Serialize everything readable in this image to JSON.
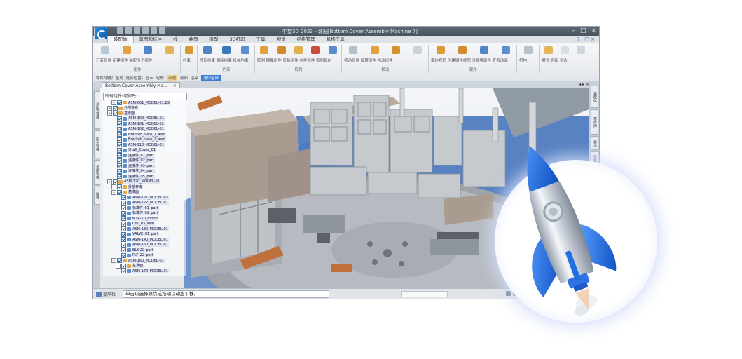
{
  "title_bar": {
    "text": "中望3D 2023 - 装配[Bottom Cover Assembly Machine 7]",
    "minimize": "–",
    "restore": "□",
    "close": "×"
  },
  "ribbon_tabs": [
    {
      "label": "装配体"
    },
    {
      "label": "草图和标注"
    },
    {
      "label": "线"
    },
    {
      "label": "曲面"
    },
    {
      "label": "造型"
    },
    {
      "label": "3D打印"
    },
    {
      "label": "工具"
    },
    {
      "label": "视觉"
    },
    {
      "label": "结构管理"
    },
    {
      "label": "机构工具"
    }
  ],
  "help": "? - □ ×",
  "ribbon_groups": [
    {
      "labels": "已有组件 新建组件 装配多个组件",
      "name": "组件"
    },
    {
      "labels": "约束",
      "name": ""
    },
    {
      "labels": "固定约束 解除约束 机械约束",
      "name": "约束"
    },
    {
      "labels": "阵列 镜像组件 复制组件 参考组件 实例复制",
      "name": "阵列"
    },
    {
      "labels": "移动组件 旋转组件 拖动组件",
      "name": "移动"
    },
    {
      "labels": "爆炸视图 创建爆炸视图 分解零部件 查看动画",
      "name": "爆炸"
    },
    {
      "labels": "机构",
      "name": ""
    },
    {
      "labels": "模式 刷新 全选",
      "name": ""
    }
  ],
  "toolbar": {
    "items": [
      "零件/装配",
      "全局 (任何位置)",
      "显示",
      "轮廓",
      "剖面",
      "渲染"
    ],
    "highlight": "半透",
    "selected": "选中全部"
  },
  "document_tab": {
    "label": "Bottom Cover Assembly Ma...",
    "close": "×",
    "controls": "◂ ▸ ×"
  },
  "left_vtabs": [
    "装配管理器",
    "历史管理",
    "视图管理",
    "属性"
  ],
  "right_vtabs": [
    "装配体",
    "零件库",
    "显示",
    "对象"
  ],
  "tree": {
    "header": "所有组件(可修改)",
    "rows": [
      {
        "label": "ASM-001_MODEL-01.Z3",
        "type": "folder"
      },
      {
        "label": "外部参考",
        "type": "folder"
      },
      {
        "label": "基准面",
        "type": "folder"
      },
      {
        "label": "ASM-100_MODEL-01",
        "type": "part"
      },
      {
        "label": "ASM-101_MODEL-02",
        "type": "part"
      },
      {
        "label": "ASM-102_MODEL-01",
        "type": "part"
      },
      {
        "label": "Bracket_plate_1_asm",
        "type": "part"
      },
      {
        "label": "Bracket_plate_2_asm",
        "type": "part"
      },
      {
        "label": "ASM-110_MODEL-01",
        "type": "part"
      },
      {
        "label": "Shaft_Cover_01",
        "type": "part"
      },
      {
        "label": "连接件_01_part",
        "type": "part"
      },
      {
        "label": "连接件_02_part",
        "type": "part"
      },
      {
        "label": "连接件_03_part",
        "type": "part"
      },
      {
        "label": "连接件_04_part",
        "type": "part"
      },
      {
        "label": "连接件_05_part",
        "type": "part"
      },
      {
        "label": "ASM-120_MODEL-01",
        "type": "folder"
      },
      {
        "label": "外部参考",
        "type": "folder"
      },
      {
        "label": "基准面",
        "type": "folder"
      },
      {
        "label": "ASM-121_MODEL-03",
        "type": "part"
      },
      {
        "label": "ASM-122_MODEL-01",
        "type": "part"
      },
      {
        "label": "标准件_01_part",
        "type": "part"
      },
      {
        "label": "标准件_02_part",
        "type": "part"
      },
      {
        "label": "MTR-10_motor",
        "type": "part"
      },
      {
        "label": "CYL_03_asm",
        "type": "part"
      },
      {
        "label": "ASM-130_MODEL-01",
        "type": "part"
      },
      {
        "label": "VALVE_01_part",
        "type": "part"
      },
      {
        "label": "ASM-140_MODEL-01",
        "type": "part"
      },
      {
        "label": "ASM-150_MODEL-01",
        "type": "part"
      },
      {
        "label": "BLK-20_part",
        "type": "part"
      },
      {
        "label": "PLT_22_part",
        "type": "part"
      },
      {
        "label": "ASM-160_MODEL-01",
        "type": "folder"
      },
      {
        "label": "基准面",
        "type": "folder"
      },
      {
        "label": "ASM-170_MODEL-01",
        "type": "part"
      }
    ]
  },
  "statusbar": {
    "cmd_label": "提示栏",
    "prompt": "单击以选择原点或拖动以动态平移。"
  },
  "colors": {
    "accent": "#2f72c4",
    "rocket_blue": "#1f6fe0",
    "panel_tan": "#a99b8d",
    "copper": "#c0703a",
    "base_blue": "#3d6fb8"
  }
}
